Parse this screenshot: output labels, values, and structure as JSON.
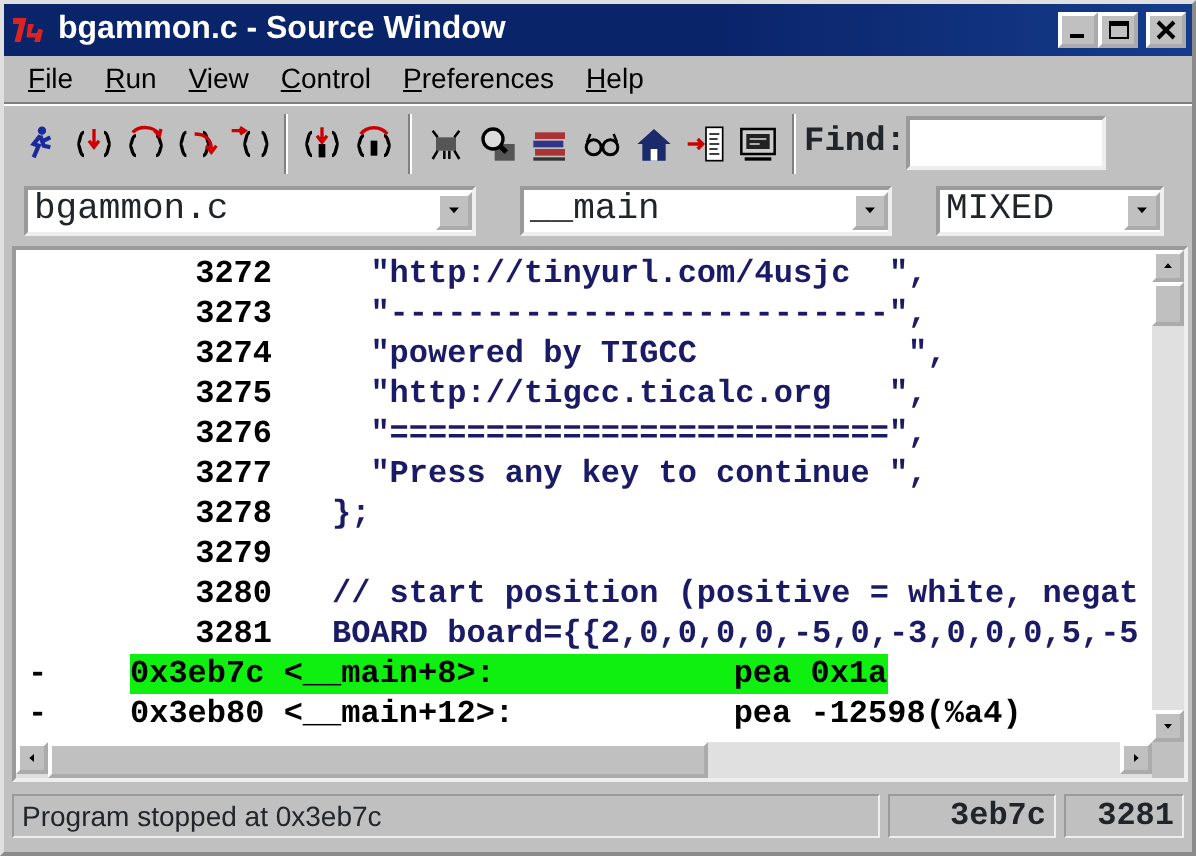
{
  "window": {
    "title": "bgammon.c - Source Window"
  },
  "menu": [
    {
      "label": "File",
      "underline_first": true
    },
    {
      "label": "Run",
      "underline_first": true
    },
    {
      "label": "View",
      "underline_first": true
    },
    {
      "label": "Control",
      "underline_first": true
    },
    {
      "label": "Preferences",
      "underline_first": true
    },
    {
      "label": "Help",
      "underline_first": true
    }
  ],
  "toolbar": {
    "groups": [
      [
        {
          "kind": "runner"
        },
        {
          "kind": "step"
        },
        {
          "kind": "next"
        },
        {
          "kind": "finish"
        },
        {
          "kind": "continue"
        }
      ],
      [
        {
          "kind": "stepi"
        },
        {
          "kind": "nexti"
        }
      ],
      [
        {
          "kind": "chip"
        },
        {
          "kind": "magnifier"
        },
        {
          "kind": "books"
        },
        {
          "kind": "glasses"
        },
        {
          "kind": "house"
        },
        {
          "kind": "arrow-list"
        },
        {
          "kind": "monitor"
        }
      ]
    ],
    "find": {
      "label": "Find:"
    }
  },
  "selectors": {
    "file": "bgammon.c",
    "function": "__main",
    "mode": "MIXED"
  },
  "code": [
    {
      "kind": "source",
      "number": "3272",
      "text": "  \"http://tinyurl.com/4usjc  \","
    },
    {
      "kind": "source",
      "number": "3273",
      "text": "  \"--------------------------\","
    },
    {
      "kind": "source",
      "number": "3274",
      "text": "  \"powered by TIGCC           \","
    },
    {
      "kind": "source",
      "number": "3275",
      "text": "  \"http://tigcc.ticalc.org   \","
    },
    {
      "kind": "source",
      "number": "3276",
      "text": "  \"==========================\","
    },
    {
      "kind": "source",
      "number": "3277",
      "text": "  \"Press any key to continue \","
    },
    {
      "kind": "source",
      "number": "3278",
      "text": "};"
    },
    {
      "kind": "source",
      "number": "3279"
    },
    {
      "kind": "source",
      "number": "3280",
      "text": "// start position (positive = white, negat"
    },
    {
      "kind": "source",
      "number": "3281",
      "text": "BOARD board={{2,0,0,0,0,-5,0,-3,0,0,0,5,-5"
    },
    {
      "kind": "asm",
      "marker": "-",
      "address": "0x3eb7c",
      "symbol": "<__main+8>:",
      "instruction": "pea 0x1a",
      "selected": true
    },
    {
      "kind": "asm",
      "marker": "-",
      "address": "0x3eb80",
      "symbol": "<__main+12>:",
      "instruction": "pea -12598(%a4)",
      "selected": false
    }
  ],
  "status_bar": {
    "message": "Program stopped at 0x3eb7c",
    "address": "3eb7c",
    "line": "3281"
  }
}
